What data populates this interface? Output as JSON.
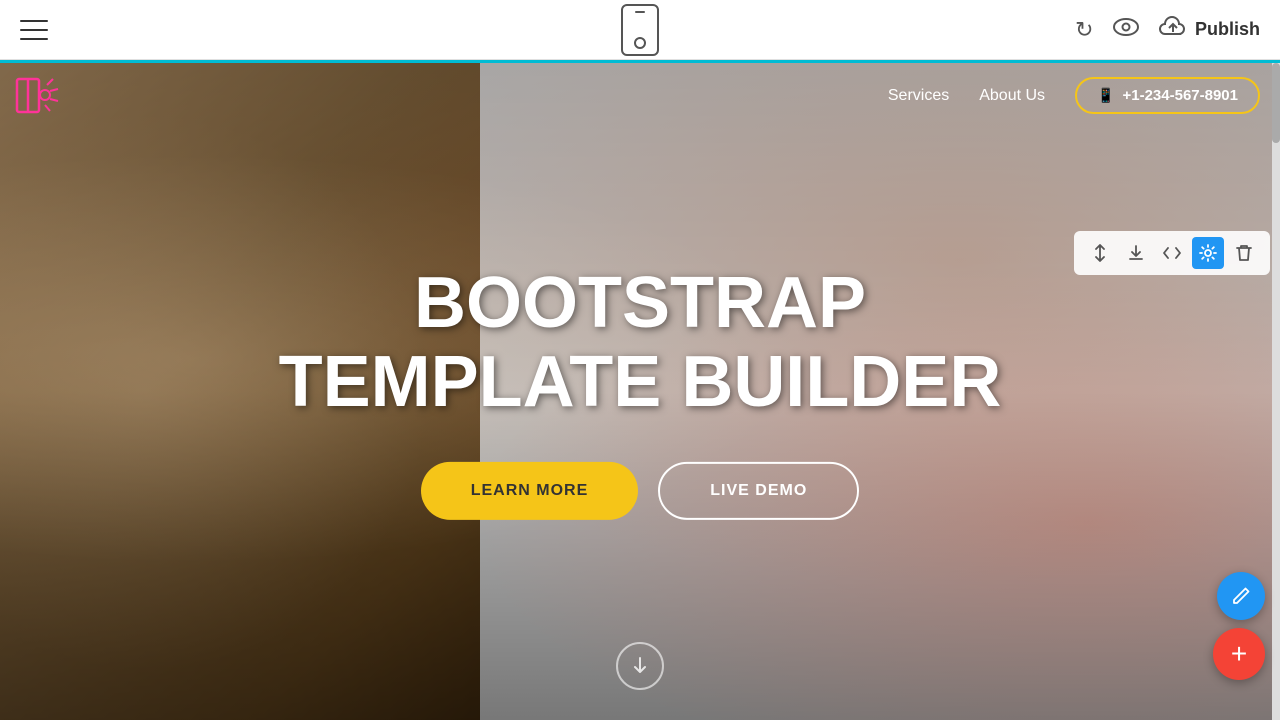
{
  "toolbar": {
    "publish_label": "Publish",
    "hamburger_label": "Menu"
  },
  "nav": {
    "services_label": "Services",
    "about_us_label": "About Us",
    "phone_number": "+1-234-567-8901"
  },
  "hero": {
    "title_line1": "BOOTSTRAP",
    "title_line2": "TEMPLATE BUILDER",
    "btn_learn_more": "LEARN MORE",
    "btn_live_demo": "LIVE DEMO"
  },
  "section_toolbar": {
    "move_icon": "⇅",
    "download_icon": "⬇",
    "code_icon": "</>",
    "settings_icon": "⚙",
    "delete_icon": "🗑"
  }
}
